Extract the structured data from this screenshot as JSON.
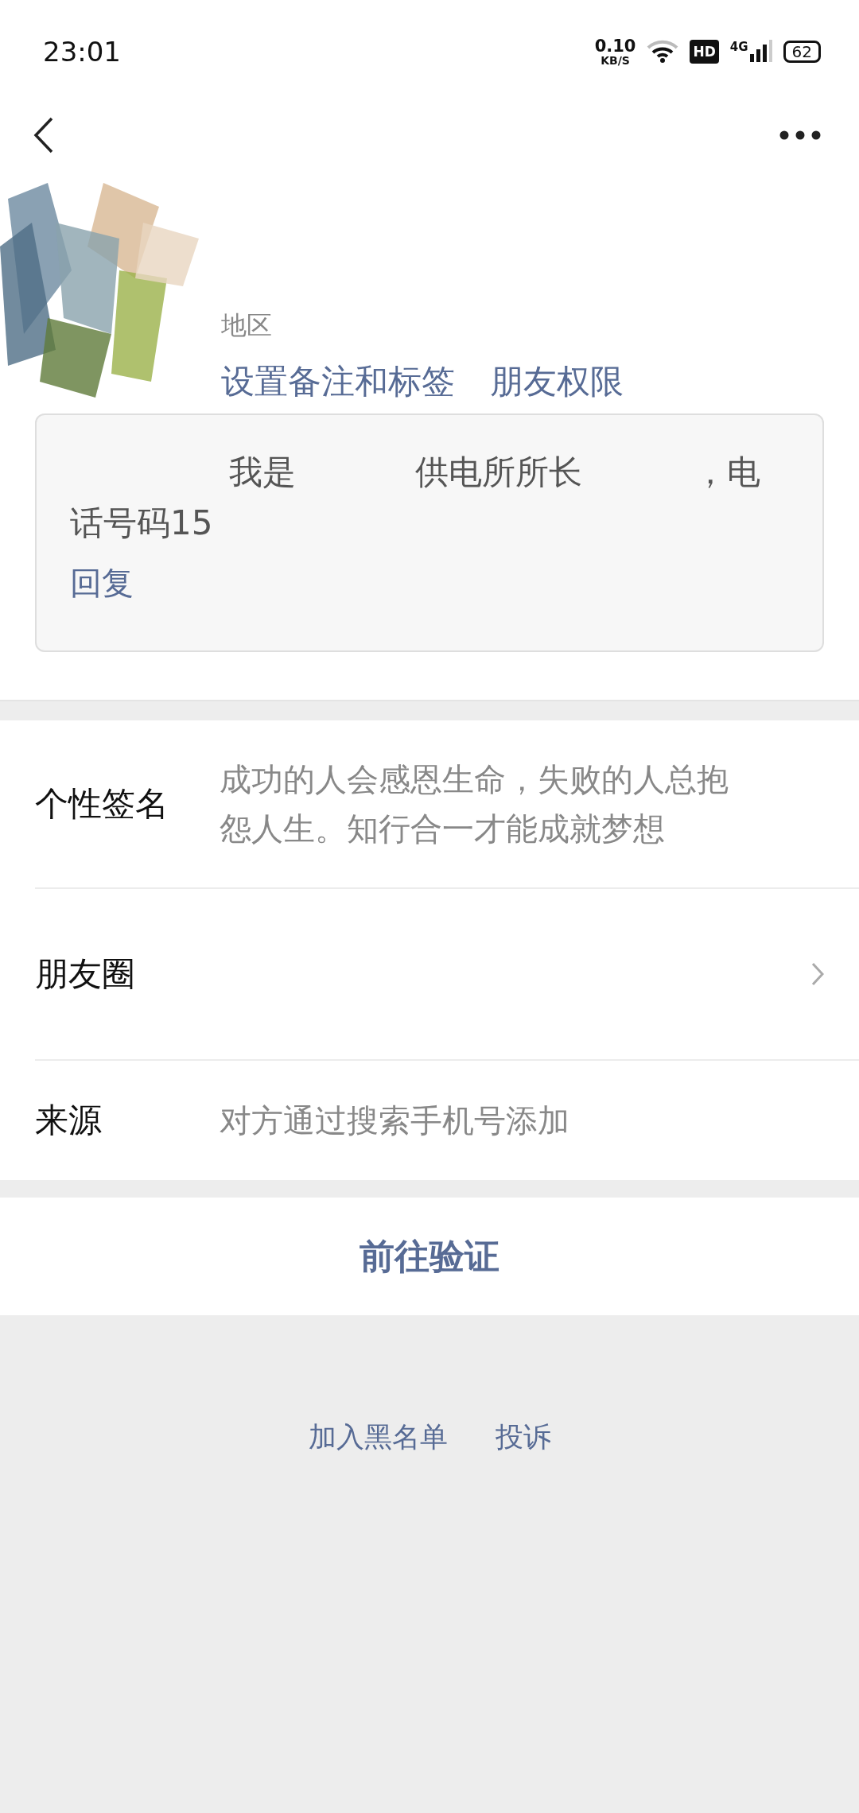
{
  "status_bar": {
    "time": "23:01",
    "net_speed": "0.10",
    "net_unit": "KB/S",
    "hd": "HD",
    "network": "4G",
    "battery": "62"
  },
  "profile": {
    "avatar": {
      "kind": "picture"
    },
    "region_label": "地区",
    "actions": [
      "设置备注和标签",
      "朋友权限"
    ]
  },
  "message": {
    "parts": [
      "我是",
      "供电所所长",
      "，电",
      "话号码15"
    ],
    "reply": "回复"
  },
  "rows": [
    {
      "label": "个性签名",
      "value": "成功的人会感恩生命，失败的人总抱怨人生。知行合一才能成就梦想",
      "kind": "text"
    },
    {
      "label": "朋友圈",
      "kind": "link"
    },
    {
      "label": "来源",
      "value": "对方通过搜索手机号添加",
      "kind": "text"
    }
  ],
  "verify_button": "前往验证",
  "footer_links": [
    "加入黑名单",
    "投诉"
  ]
}
